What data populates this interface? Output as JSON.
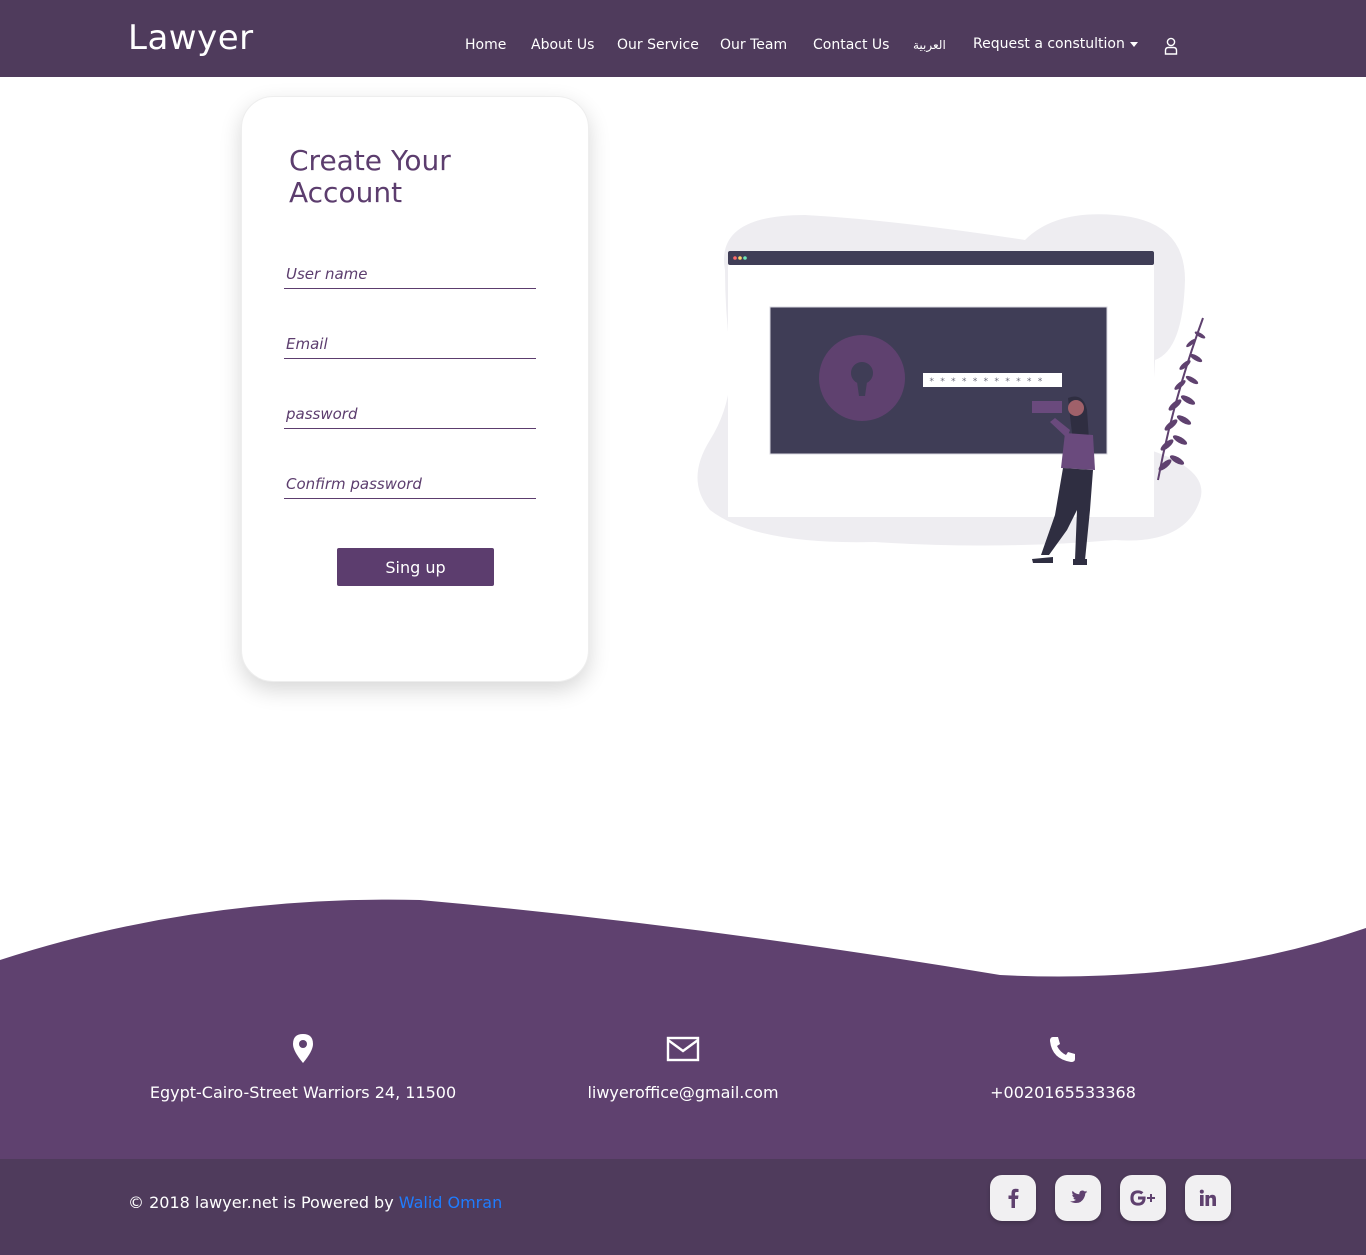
{
  "navbar": {
    "brand": "Lawyer",
    "items": [
      "Home",
      "About Us",
      "Our Service",
      "Our Team",
      "Contact Us",
      "العربية",
      "Request a constultion"
    ],
    "user_icon": "user-icon"
  },
  "signup": {
    "title": "Create Your Account",
    "fields": {
      "username_placeholder": "User name",
      "email_placeholder": "Email",
      "password_placeholder": "password",
      "confirm_placeholder": "Confirm password"
    },
    "button": "Sing up"
  },
  "illustration": {
    "password_mask": "* * * * * * * * * * *"
  },
  "footer": {
    "contacts": [
      {
        "icon": "map-marker-icon",
        "text": "Egypt-Cairo-Street Warriors 24, 11500"
      },
      {
        "icon": "envelope-icon",
        "text": "liwyeroffice@gmail.com"
      },
      {
        "icon": "phone-icon",
        "text": "+0020165533368"
      }
    ],
    "copyright_prefix": "© 2018 lawyer.net is Powered by ",
    "copyright_author": "Walid Omran",
    "social": [
      "facebook-icon",
      "twitter-icon",
      "google-plus-icon",
      "linkedin-icon"
    ]
  },
  "colors": {
    "primary": "#5c3d6e",
    "navbar": "#4f3b5c",
    "footer": "#5f416f",
    "link": "#1f7cff"
  }
}
